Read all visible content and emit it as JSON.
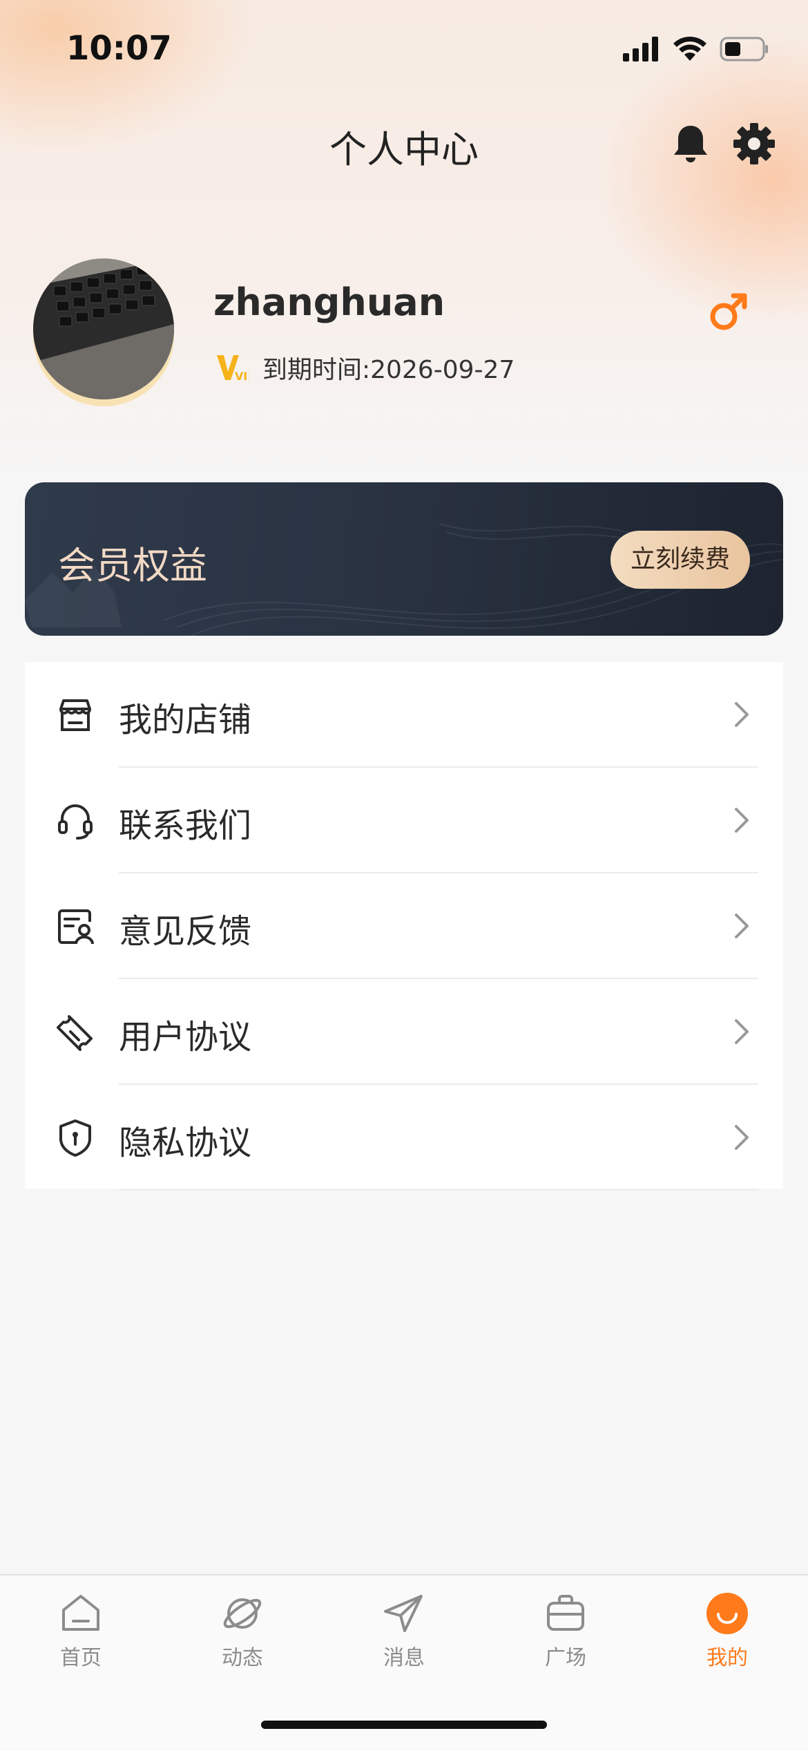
{
  "status_bar": {
    "time": "10:07"
  },
  "header": {
    "title": "个人中心",
    "icons": [
      "bell-icon",
      "gear-icon"
    ]
  },
  "profile": {
    "username": "zhanghuan",
    "vip_badge": "VIP",
    "expire_text": "到期时间:2026-09-27",
    "gender_icon": "male-icon"
  },
  "member_card": {
    "title": "会员权益",
    "button_label": "立刻续费"
  },
  "menu": {
    "items": [
      {
        "label": "我的店铺",
        "icon": "store-icon"
      },
      {
        "label": "联系我们",
        "icon": "headset-icon"
      },
      {
        "label": "意见反馈",
        "icon": "feedback-icon"
      },
      {
        "label": "用户协议",
        "icon": "ticket-icon"
      },
      {
        "label": "隐私协议",
        "icon": "shield-icon"
      }
    ]
  },
  "tab_bar": {
    "tabs": [
      {
        "label": "首页",
        "icon": "home-icon"
      },
      {
        "label": "动态",
        "icon": "planet-icon"
      },
      {
        "label": "消息",
        "icon": "send-icon"
      },
      {
        "label": "广场",
        "icon": "briefcase-icon"
      },
      {
        "label": "我的",
        "icon": "smile-icon",
        "active": true
      }
    ]
  },
  "colors": {
    "accent": "#ff7a1a",
    "card_dark": "#2a3342",
    "gold": "#f2d9c4"
  }
}
